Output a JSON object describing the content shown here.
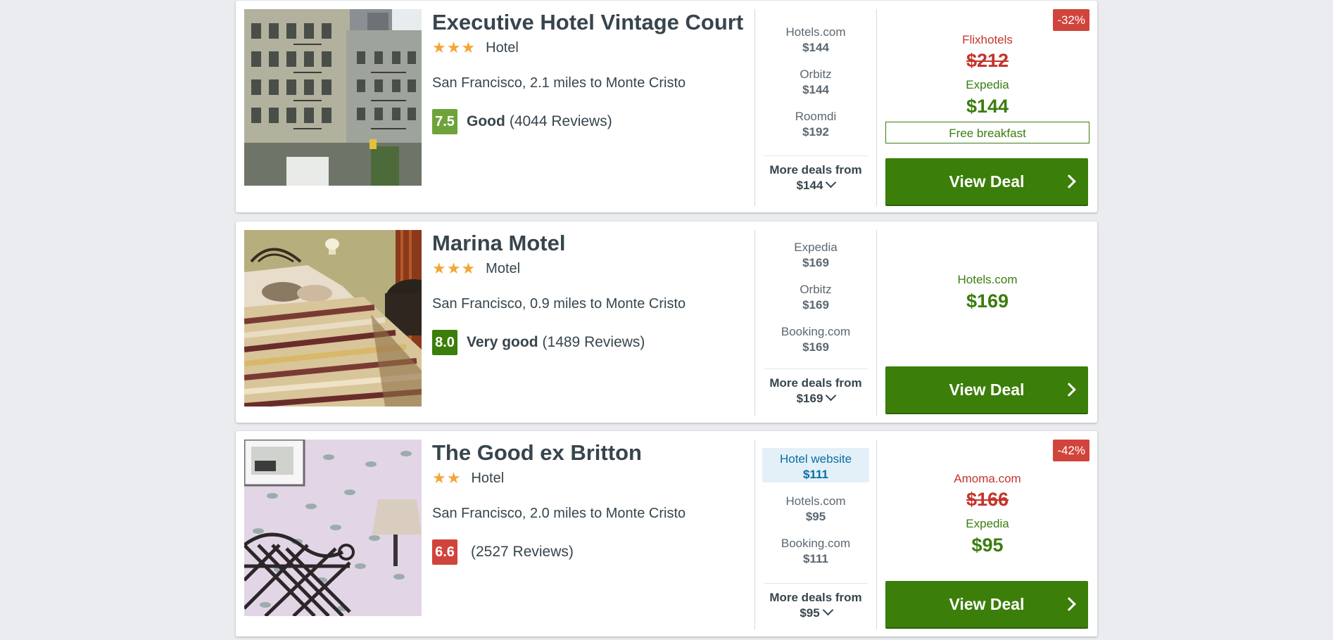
{
  "colors": {
    "page_bg": "#ebecef",
    "star": "#f3a636",
    "deal_button": "#3b7e09",
    "discount_badge": "#d1443b",
    "score_green": "#6ea33c",
    "score_dark_green": "#3b7e09",
    "score_red": "#d1443b"
  },
  "hotels": [
    {
      "name": "Executive Hotel Vintage Court",
      "stars": "★★★",
      "type": "Hotel",
      "location": "San Francisco, 2.1 miles to Monte Cristo",
      "score": "7.5",
      "rating_label": "Good",
      "reviews": "(4044 Reviews)",
      "deals": [
        {
          "provider": "Hotels.com",
          "price": "$144"
        },
        {
          "provider": "Orbitz",
          "price": "$144"
        },
        {
          "provider": "Roomdi",
          "price": "$192"
        }
      ],
      "more_label": "More deals from",
      "more_price": "$144",
      "discount": "-32%",
      "old_provider": "Flixhotels",
      "old_price": "$212",
      "best_provider": "Expedia",
      "best_price": "$144",
      "perk": "Free breakfast",
      "button": "View Deal"
    },
    {
      "name": "Marina Motel",
      "stars": "★★★",
      "type": "Motel",
      "location": "San Francisco, 0.9 miles to Monte Cristo",
      "score": "8.0",
      "rating_label": "Very good",
      "reviews": "(1489 Reviews)",
      "deals": [
        {
          "provider": "Expedia",
          "price": "$169"
        },
        {
          "provider": "Orbitz",
          "price": "$169"
        },
        {
          "provider": "Booking.com",
          "price": "$169"
        }
      ],
      "more_label": "More deals from",
      "more_price": "$169",
      "best_provider": "Hotels.com",
      "best_price": "$169",
      "button": "View Deal"
    },
    {
      "name": "The Good ex Britton",
      "stars": "★★",
      "type": "Hotel",
      "location": "San Francisco, 2.0 miles to Monte Cristo",
      "score": "6.6",
      "rating_label": "",
      "reviews": "(2527 Reviews)",
      "deals": [
        {
          "provider": "Hotel website",
          "price": "$111"
        },
        {
          "provider": "Hotels.com",
          "price": "$95"
        },
        {
          "provider": "Booking.com",
          "price": "$111"
        }
      ],
      "more_label": "More deals from",
      "more_price": "$95",
      "discount": "-42%",
      "old_provider": "Amoma.com",
      "old_price": "$166",
      "best_provider": "Expedia",
      "best_price": "$95",
      "button": "View Deal"
    }
  ]
}
